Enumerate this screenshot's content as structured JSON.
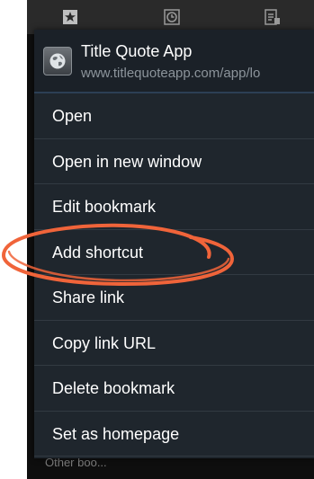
{
  "tabs": [
    {
      "icon": "star-icon"
    },
    {
      "icon": "clock-icon"
    },
    {
      "icon": "saved-pages-icon"
    }
  ],
  "background": {
    "bottom_label": "Other boo..."
  },
  "dialog": {
    "favicon": "globe-icon",
    "title": "Title Quote App",
    "url": "www.titlequoteapp.com/app/lo",
    "items": [
      {
        "label": "Open"
      },
      {
        "label": "Open in new window"
      },
      {
        "label": "Edit bookmark"
      },
      {
        "label": "Add shortcut"
      },
      {
        "label": "Share link"
      },
      {
        "label": "Copy link URL"
      },
      {
        "label": "Delete bookmark"
      },
      {
        "label": "Set as homepage"
      }
    ]
  },
  "annotation": {
    "color": "#f0643a",
    "target": "Add shortcut"
  }
}
